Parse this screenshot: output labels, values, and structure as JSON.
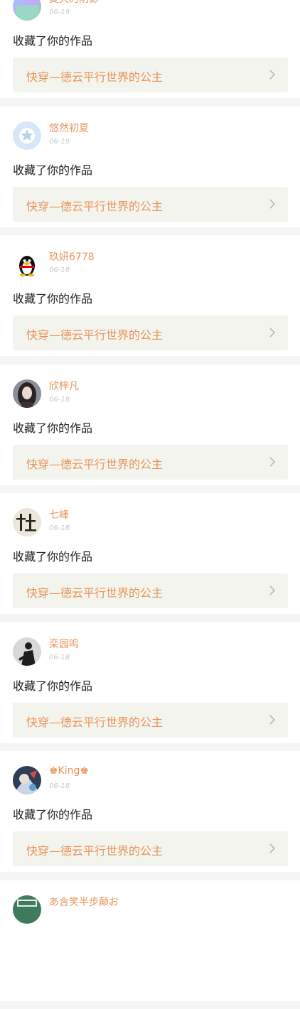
{
  "colors": {
    "accent": "#e8945a",
    "work_bg": "#f4f4ee",
    "separator": "#f5f5f5",
    "date": "#c8c8c8"
  },
  "items": [
    {
      "username": "夏天的阴影",
      "date": "06-19",
      "action": "收藏了你的作品",
      "work_title": "快穿—德云平行世界的公主",
      "avatar_icon": "gradient-avatar-icon"
    },
    {
      "username": "悠然初夏",
      "date": "06-19",
      "action": "收藏了你的作品",
      "work_title": "快穿—德云平行世界的公主",
      "avatar_icon": "star-avatar-icon"
    },
    {
      "username": "玖妍6778",
      "date": "06-18",
      "action": "收藏了你的作品",
      "work_title": "快穿—德云平行世界的公主",
      "avatar_icon": "penguin-avatar-icon"
    },
    {
      "username": "欣梓凡",
      "date": "06-18",
      "action": "收藏了你的作品",
      "work_title": "快穿—德云平行世界的公主",
      "avatar_icon": "girl-portrait-avatar-icon"
    },
    {
      "username": "七峰",
      "date": "06-18",
      "action": "收藏了你的作品",
      "work_title": "快穿—德云平行世界的公主",
      "avatar_icon": "calligraphy-avatar-icon"
    },
    {
      "username": "栾园鸣",
      "date": "06-18",
      "action": "收藏了你的作品",
      "work_title": "快穿—德云平行世界的公主",
      "avatar_icon": "bw-portrait-avatar-icon"
    },
    {
      "username": "♚King♚",
      "date": "06-18",
      "action": "收藏了你的作品",
      "work_title": "快穿—德云平行世界的公主",
      "avatar_icon": "cartoon-avatar-icon"
    },
    {
      "username": "あ含笑半步颠お",
      "date": "",
      "action": "",
      "work_title": "",
      "avatar_icon": "green-avatar-icon"
    }
  ]
}
